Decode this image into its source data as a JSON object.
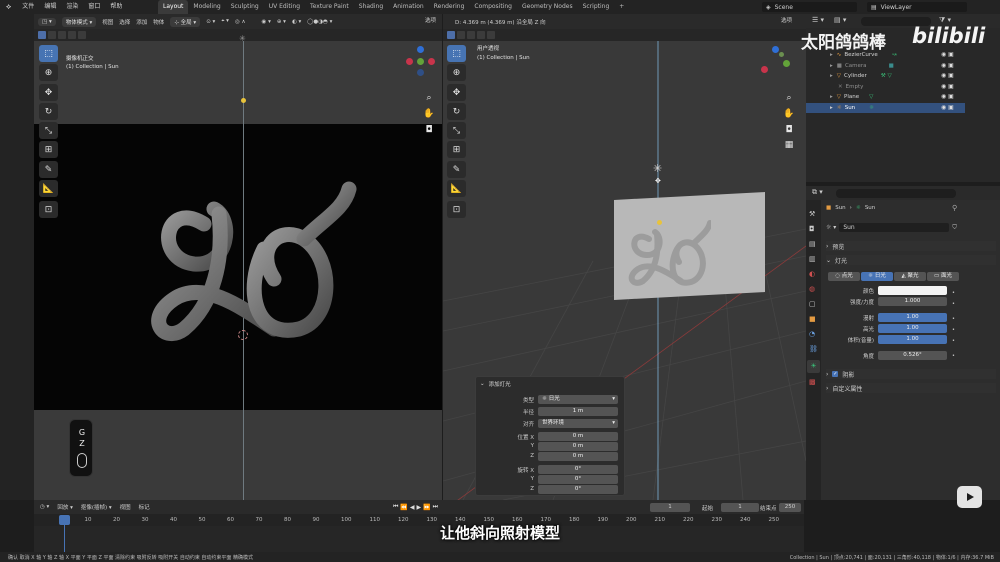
{
  "topbar": {
    "menus": [
      "文件",
      "编辑",
      "渲染",
      "窗口",
      "帮助"
    ],
    "workspaces": [
      "Layout",
      "Modeling",
      "Sculpting",
      "UV Editing",
      "Texture Paint",
      "Shading",
      "Animation",
      "Rendering",
      "Compositing",
      "Geometry Nodes",
      "Scripting"
    ],
    "active_workspace": "Layout",
    "add_tab": "+",
    "scene": "Scene",
    "view_layer": "ViewLayer"
  },
  "left_view": {
    "mode": "物体模式",
    "menus": [
      "视图",
      "选择",
      "添加",
      "物体"
    ],
    "orientation": "全局",
    "options": "选项",
    "title": "摄像机正交",
    "subtitle": "(1) Collection | Sun"
  },
  "right_view": {
    "status": "D: 4.369 m (4.369 m) 沿全局 Z 向",
    "options": "选项",
    "title": "用户透视",
    "subtitle": "(1) Collection | Sun"
  },
  "keys": [
    "G",
    "Z"
  ],
  "watermark": "太阳鸽鸽棒",
  "bili_logo": "bilibili",
  "outliner": {
    "items": [
      {
        "name": "BezierCurve",
        "color": "#e49b42"
      },
      {
        "name": "Camera",
        "color": "#7f7f7f"
      },
      {
        "name": "Cylinder",
        "color": "#e49b42"
      },
      {
        "name": "Empty",
        "color": "#7f7f7f"
      },
      {
        "name": "Plane",
        "color": "#e49b42"
      },
      {
        "name": "Sun",
        "color": "#e49b42"
      }
    ]
  },
  "properties": {
    "object_name": "Sun",
    "data_name": "Sun",
    "light_name": "Sun",
    "preview_label": "预览",
    "light_panel": "灯光",
    "light_types": [
      "点光",
      "日光",
      "聚光",
      "面光"
    ],
    "active_light_type": "日光",
    "color_label": "颜色",
    "strength_label": "强度/力度",
    "strength": "1.000",
    "diffuse_label": "漫射",
    "diffuse": "1.00",
    "specular_label": "高光",
    "specular": "1.00",
    "volume_label": "体积(音量)",
    "volume": "1.00",
    "angle_label": "角度",
    "angle": "0.526°",
    "shadow_label": "阴影",
    "custom_props_label": "自定义属性"
  },
  "adjust_panel": {
    "title": "添加灯光",
    "rows": [
      {
        "label": "类型",
        "value": "日光"
      },
      {
        "label": "半径",
        "value": "1 m"
      },
      {
        "label": "对齐",
        "value": "世界环境"
      },
      {
        "label": "位置 X",
        "value": "0 m"
      },
      {
        "label": "Y",
        "value": "0 m"
      },
      {
        "label": "Z",
        "value": "0 m"
      },
      {
        "label": "旋转 X",
        "value": "0°"
      },
      {
        "label": "Y",
        "value": "0°"
      },
      {
        "label": "Z",
        "value": "0°"
      }
    ]
  },
  "timeline": {
    "menus": [
      "回放",
      "抠像(插帧)",
      "视图",
      "标记"
    ],
    "current_frame": "1",
    "start_label": "起始",
    "start": "1",
    "end_label": "结束点",
    "end": "250",
    "ticks": [
      "1",
      "10",
      "20",
      "30",
      "40",
      "50",
      "60",
      "70",
      "80",
      "90",
      "100",
      "110",
      "120",
      "130",
      "140",
      "150",
      "160",
      "170",
      "180",
      "190",
      "200",
      "210",
      "220",
      "230",
      "240",
      "250"
    ]
  },
  "subtitle": "让他斜向照射模型",
  "statusbar": {
    "left": "确认  取消  X 轴  Y 轴  Z 轴  X 平面  Y 平面  Z 平面  清除约束  吸附反转  吸附开关  自动约束  自动约束平面  精确模式",
    "right": "Collection | Sun | 顶点:20,741 | 面:20,131 | 三角形:40,118 | 物体:1/6 | 内存:36.7 MiB"
  }
}
